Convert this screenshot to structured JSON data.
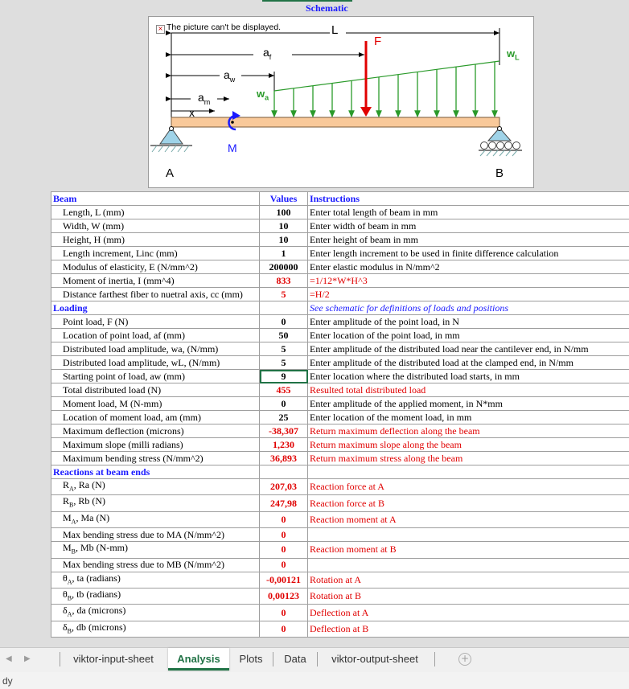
{
  "schematic": {
    "title": "Schematic",
    "broken_image_text": "The picture can't be displayed.",
    "labels": {
      "L": "L",
      "af": "a",
      "af_sub": "f",
      "F": "F",
      "wL": "w",
      "wL_sub": "L",
      "aw": "a",
      "aw_sub": "w",
      "am": "a",
      "am_sub": "m",
      "wa": "w",
      "wa_sub": "a",
      "x": "x",
      "M": "M",
      "A": "A",
      "B": "B"
    }
  },
  "table": {
    "header": {
      "name": "Beam",
      "values": "Values",
      "instructions": "Instructions"
    },
    "rows": [
      {
        "name": "Length, L (mm)",
        "value": "100",
        "instr": "Enter total length of beam in mm"
      },
      {
        "name": "Width, W (mm)",
        "value": "10",
        "instr": "Enter width of beam in mm"
      },
      {
        "name": "Height, H (mm)",
        "value": "10",
        "instr": "Enter height of beam in mm"
      },
      {
        "name": "Length increment, Linc (mm)",
        "value": "1",
        "instr": "Enter length increment to be used in finite difference calculation"
      },
      {
        "name": "Modulus of elasticity, E (N/mm^2)",
        "value": "200000",
        "instr": "Enter elastic modulus in N/mm^2"
      },
      {
        "name": "Moment of inertia, I (mm^4)",
        "value": "833",
        "instr": "=1/12*W*H^3"
      },
      {
        "name": "Distance farthest fiber to nuetral axis, cc (mm)",
        "value": "5",
        "instr": "=H/2"
      }
    ],
    "loading_header": {
      "name": "Loading",
      "instr": "See schematic for definitions of loads and positions"
    },
    "loading_rows": [
      {
        "name": "Point load, F (N)",
        "value": "0",
        "instr": "Enter amplitude of the point load, in N"
      },
      {
        "name": "Location of point load, af (mm)",
        "value": "50",
        "instr": "Enter location of the point load, in mm"
      },
      {
        "name": "Distributed load amplitude, wa, (N/mm)",
        "value": "5",
        "instr": "Enter amplitude of the distributed load near the cantilever end, in N/mm"
      },
      {
        "name": "Distributed load amplitude, wL, (N/mm)",
        "value": "5",
        "instr": "Enter amplitude of the distributed load at the clamped end, in N/mm"
      },
      {
        "name": "Starting point of load, aw (mm)",
        "value": "9",
        "instr": "Enter location where the distributed load starts, in mm"
      },
      {
        "name": "Total distributed load (N)",
        "value": "455",
        "instr": "Resulted total distributed load"
      },
      {
        "name": "Moment load, M (N-mm)",
        "value": "0",
        "instr": "Enter amplitude of the applied moment, in N*mm"
      },
      {
        "name": "Location of moment load, am (mm)",
        "value": "25",
        "instr": "Enter location of the moment load, in mm"
      },
      {
        "name": "Maximum deflection (microns)",
        "value": "-38,307",
        "instr": "Return maximum deflection along the beam"
      },
      {
        "name": "Maximum slope (milli radians)",
        "value": "1,230",
        "instr": "Return maximum slope along the beam"
      },
      {
        "name": "Maximum bending stress (N/mm^2)",
        "value": "36,893",
        "instr": "Return maximum stress along the beam"
      }
    ],
    "reactions_header": "Reactions at beam ends",
    "reaction_rows": [
      {
        "sym": "R",
        "sub": "A",
        "name": ", Ra (N)",
        "value": "207,03",
        "instr": "Reaction force at A"
      },
      {
        "sym": "R",
        "sub": "B",
        "name": ", Rb (N)",
        "value": "247,98",
        "instr": "Reaction force at B"
      },
      {
        "sym": "M",
        "sub": "A",
        "name": ", Ma (N)",
        "value": "0",
        "instr": "Reaction moment at A"
      },
      {
        "sym": "",
        "sub": "",
        "name": "Max bending stress due to MA (N/mm^2)",
        "value": "0",
        "instr": ""
      },
      {
        "sym": "M",
        "sub": "B",
        "name": ", Mb (N-mm)",
        "value": "0",
        "instr": "Reaction moment at B"
      },
      {
        "sym": "",
        "sub": "",
        "name": "Max bending stress due to MB (N/mm^2)",
        "value": "0",
        "instr": ""
      },
      {
        "sym": "θ",
        "sub": "A",
        "name": ", ta (radians)",
        "value": "-0,00121",
        "instr": "Rotation at A"
      },
      {
        "sym": "θ",
        "sub": "B",
        "name": ", tb (radians)",
        "value": "0,00123",
        "instr": "Rotation at B"
      },
      {
        "sym": "δ",
        "sub": "A",
        "name": ", da (microns)",
        "value": "0",
        "instr": "Deflection at A"
      },
      {
        "sym": "δ",
        "sub": "B",
        "name": ", db (microns)",
        "value": "0",
        "instr": "Deflection at B"
      }
    ]
  },
  "tabs": [
    {
      "label": "viktor-input-sheet",
      "active": false
    },
    {
      "label": "Analysis",
      "active": true
    },
    {
      "label": "Plots",
      "active": false
    },
    {
      "label": "Data",
      "active": false
    },
    {
      "label": "viktor-output-sheet",
      "active": false
    }
  ],
  "status": {
    "text": "dy"
  },
  "colors": {
    "accent": "#217346",
    "header_blue": "#1a1aff",
    "result_red": "#e00000"
  }
}
